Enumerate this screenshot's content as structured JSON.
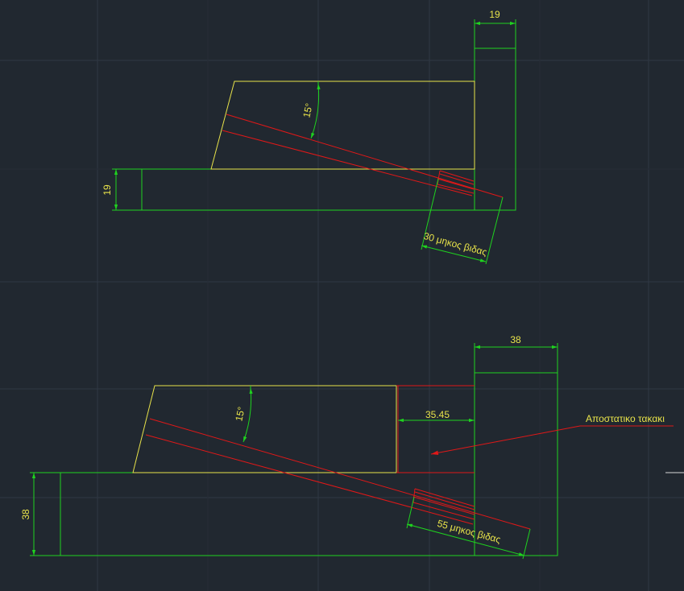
{
  "colors": {
    "background": "#212830",
    "grid": "#2f3844",
    "geometry_green": "#1fd21f",
    "profile_yellow": "#e8e34a",
    "screw_red": "#e01818",
    "text_yellow": "#e8e34a"
  },
  "top_view": {
    "dim_width": "19",
    "dim_height": "19",
    "angle": "15°",
    "screw_length": "30 μηκος βιδας"
  },
  "bottom_view": {
    "dim_width": "38",
    "dim_height": "38",
    "angle": "15°",
    "spacer_dim": "35.45",
    "screw_length": "55 μηκος βιδας",
    "spacer_note": "Αποστατικο τακακι"
  }
}
